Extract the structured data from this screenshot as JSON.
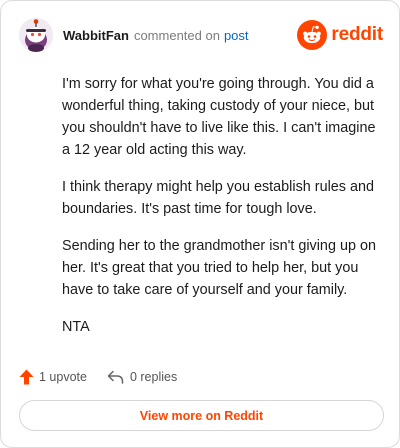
{
  "comment": {
    "author": "WabbitFan",
    "action": "commented on",
    "post_link": "post",
    "paragraphs": [
      "I'm sorry for what you're going through. You did a wonderful thing, taking custody of your niece, but you shouldn't have to live like this. I can't imagine a 12 year old acting this way.",
      "I think therapy might help you establish rules and boundaries. It's past time for tough love.",
      "Sending her to the grandmother isn't giving up on her. It's great that you tried to help her, but you have to take care of yourself and your family.",
      "NTA"
    ]
  },
  "brand": {
    "wordmark": "reddit",
    "icon": "reddit-snoo-icon",
    "color": "#ff4500"
  },
  "footer": {
    "upvotes": "1 upvote",
    "replies": "0 replies",
    "upvote_icon": "upvote-arrow-icon",
    "reply_icon": "reply-arrow-icon",
    "upvote_color": "#ff4500"
  },
  "actions": {
    "view_more": "View more on Reddit"
  },
  "avatar": {
    "icon": "avatar-snoo-icon"
  }
}
